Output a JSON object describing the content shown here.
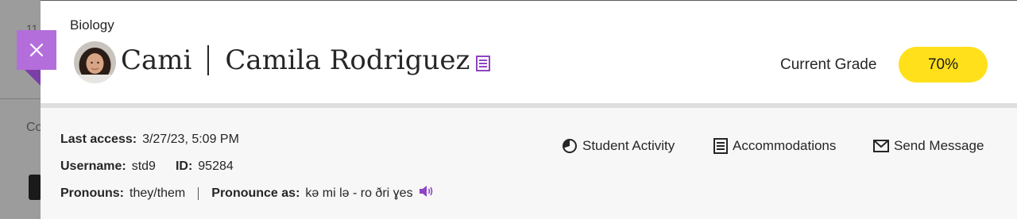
{
  "background": {
    "partial_text_top": "11",
    "partial_text_mid": "Co"
  },
  "header": {
    "course": "Biology",
    "preferred_name": "Cami",
    "full_name": "Camila Rodriguez",
    "grade_label": "Current Grade",
    "grade_value": "70%"
  },
  "details": {
    "last_access_label": "Last access:",
    "last_access_value": "3/27/23, 5:09 PM",
    "username_label": "Username:",
    "username_value": "std9",
    "id_label": "ID:",
    "id_value": "95284",
    "pronouns_label": "Pronouns:",
    "pronouns_value": "they/them",
    "pronounce_label": "Pronounce as:",
    "pronounce_value": "kə mi lə - ro ðri ɣes"
  },
  "actions": {
    "student_activity": "Student Activity",
    "accommodations": "Accommodations",
    "send_message": "Send Message"
  },
  "colors": {
    "accent_purple": "#8e44c4",
    "close_button": "#b46edb",
    "grade_pill": "#ffe01a"
  }
}
